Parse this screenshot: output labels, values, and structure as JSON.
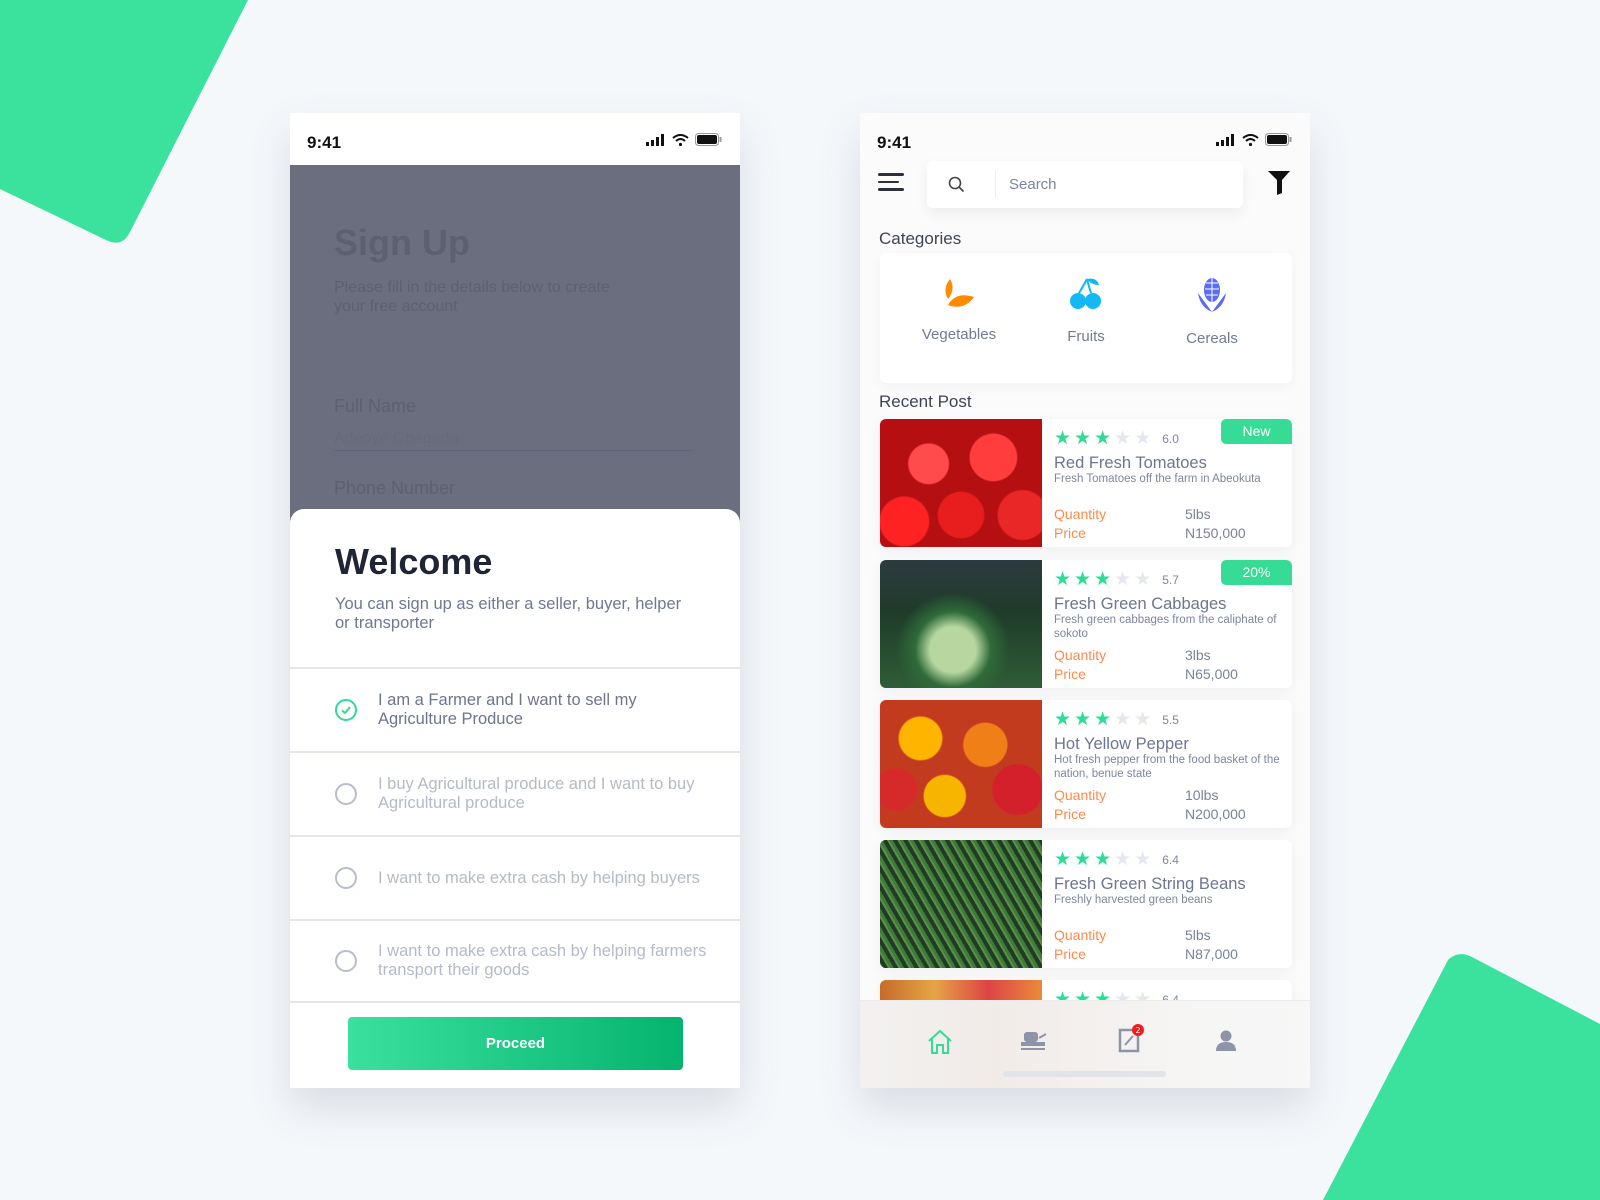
{
  "colors": {
    "accent": "#36dc96",
    "orange": "#fd8a4b",
    "background": "#f5f8fb"
  },
  "left_phone": {
    "status_time": "9:41",
    "background_form": {
      "title": "Sign Up",
      "subtitle": "Please fill in the details below to create your free account",
      "full_name_label": "Full Name",
      "full_name_value": "Adeoye Gbagada",
      "phone_label": "Phone Number"
    },
    "sheet": {
      "title": "Welcome",
      "subtitle": "You can sign up as either a seller, buyer, helper or transporter",
      "options": [
        {
          "label": "I am a Farmer and I want to sell my Agriculture Produce",
          "selected": true
        },
        {
          "label": "I buy Agricultural produce and I want to buy Agricultural produce",
          "selected": false
        },
        {
          "label": "I want to make extra cash by helping buyers",
          "selected": false
        },
        {
          "label": "I want to make extra cash by helping farmers transport their goods",
          "selected": false
        }
      ],
      "proceed_label": "Proceed"
    }
  },
  "right_phone": {
    "status_time": "9:41",
    "search_placeholder": "Search",
    "categories_title": "Categories",
    "categories": [
      {
        "label": "Vegetables",
        "icon": "leaf-icon",
        "color": "#ff8a00"
      },
      {
        "label": "Fruits",
        "icon": "cherry-icon",
        "color": "#13b8f5"
      },
      {
        "label": "Cereals",
        "icon": "corn-icon",
        "color": "#5b6cf0"
      }
    ],
    "recent_title": "Recent Post",
    "quantity_label": "Quantity",
    "price_label": "Price",
    "posts": [
      {
        "title": "Red Fresh Tomatoes",
        "desc": "Fresh Tomatoes off the farm in Abeokuta",
        "rating": "6.0",
        "stars": 3,
        "quantity": "5lbs",
        "price": "N150,000",
        "badge": "New"
      },
      {
        "title": "Fresh Green Cabbages",
        "desc": "Fresh green cabbages from the caliphate of sokoto",
        "rating": "5.7",
        "stars": 3,
        "quantity": "3lbs",
        "price": "N65,000",
        "badge": "20%"
      },
      {
        "title": "Hot Yellow Pepper",
        "desc": "Hot fresh pepper from the food basket of the nation, benue state",
        "rating": "5.5",
        "stars": 3,
        "quantity": "10lbs",
        "price": "N200,000"
      },
      {
        "title": "Fresh Green String Beans",
        "desc": "Freshly harvested green beans",
        "rating": "6.4",
        "stars": 3,
        "quantity": "5lbs",
        "price": "N87,000"
      },
      {
        "rating": "6.4",
        "stars": 3
      }
    ],
    "nav": [
      {
        "icon": "home-icon",
        "active": true
      },
      {
        "icon": "tractor-icon"
      },
      {
        "icon": "orders-icon",
        "badge": "2"
      },
      {
        "icon": "profile-icon"
      }
    ]
  }
}
